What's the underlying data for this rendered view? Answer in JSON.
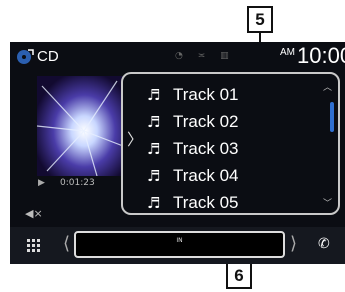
{
  "callouts": {
    "list": "5",
    "info": "6"
  },
  "header": {
    "source": "CD",
    "ampm": "AM",
    "time": "10:00"
  },
  "playback": {
    "elapsed": "0:01:23"
  },
  "tracks": [
    "Track 01",
    "Track 02",
    "Track 03",
    "Track 04",
    "Track 05"
  ],
  "bottom": {
    "info": "IN"
  },
  "colors": {
    "accent": "#2f6fd0",
    "screen_bg": "#0b0d13"
  },
  "icons": [
    "cd-source-icon",
    "music-note-icon",
    "grid-menu-icon",
    "phone-icon",
    "mute-icon",
    "play-icon"
  ]
}
